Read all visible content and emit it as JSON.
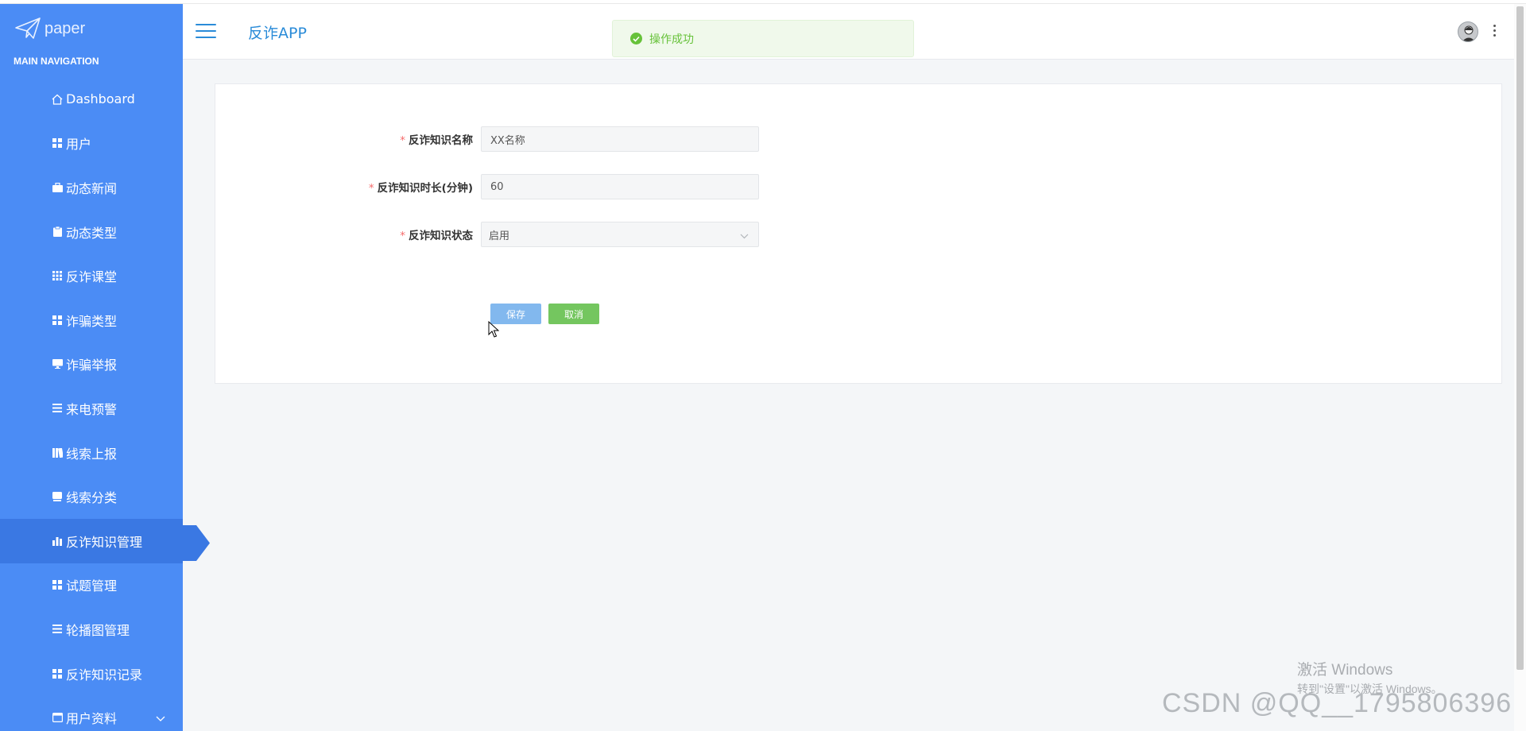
{
  "sidebar": {
    "logo_text": "paper",
    "heading": "MAIN NAVIGATION",
    "items": [
      {
        "label": "Dashboard",
        "icon": "home-icon"
      },
      {
        "label": "用户",
        "icon": "grid-icon"
      },
      {
        "label": "动态新闻",
        "icon": "briefcase-icon"
      },
      {
        "label": "动态类型",
        "icon": "clipboard-icon"
      },
      {
        "label": "反诈课堂",
        "icon": "grid-icon"
      },
      {
        "label": "诈骗类型",
        "icon": "grid-icon"
      },
      {
        "label": "诈骗举报",
        "icon": "monitor-icon"
      },
      {
        "label": "来电预警",
        "icon": "list-icon"
      },
      {
        "label": "线索上报",
        "icon": "book-icon"
      },
      {
        "label": "线索分类",
        "icon": "card-icon"
      },
      {
        "label": "反诈知识管理",
        "icon": "bar-chart-icon",
        "active": true
      },
      {
        "label": "试题管理",
        "icon": "grid-icon"
      },
      {
        "label": "轮播图管理",
        "icon": "list-icon"
      },
      {
        "label": "反诈知识记录",
        "icon": "grid-icon"
      },
      {
        "label": "用户资料",
        "icon": "calendar-icon",
        "has_chevron": true
      }
    ]
  },
  "header": {
    "title": "反诈APP"
  },
  "toast": {
    "message": "操作成功",
    "color": "#67c23a"
  },
  "form": {
    "fields": [
      {
        "label": "反诈知识名称",
        "value": "XX名称",
        "required": true
      },
      {
        "label": "反诈知识时长(分钟)",
        "value": "60",
        "required": true
      },
      {
        "label": "反诈知识状态",
        "value": "启用",
        "required": true,
        "type": "select"
      }
    ],
    "save_label": "保存",
    "cancel_label": "取消"
  },
  "watermark": {
    "windows_line1": "激活 Windows",
    "windows_line2": "转到\"设置\"以激活 Windows。",
    "csdn": "CSDN @QQ__1795806396"
  },
  "colors": {
    "sidebar": "#4b8cf5",
    "active": "#3a78e3",
    "accent": "#2a8bd8",
    "required": "#f56c6c"
  }
}
